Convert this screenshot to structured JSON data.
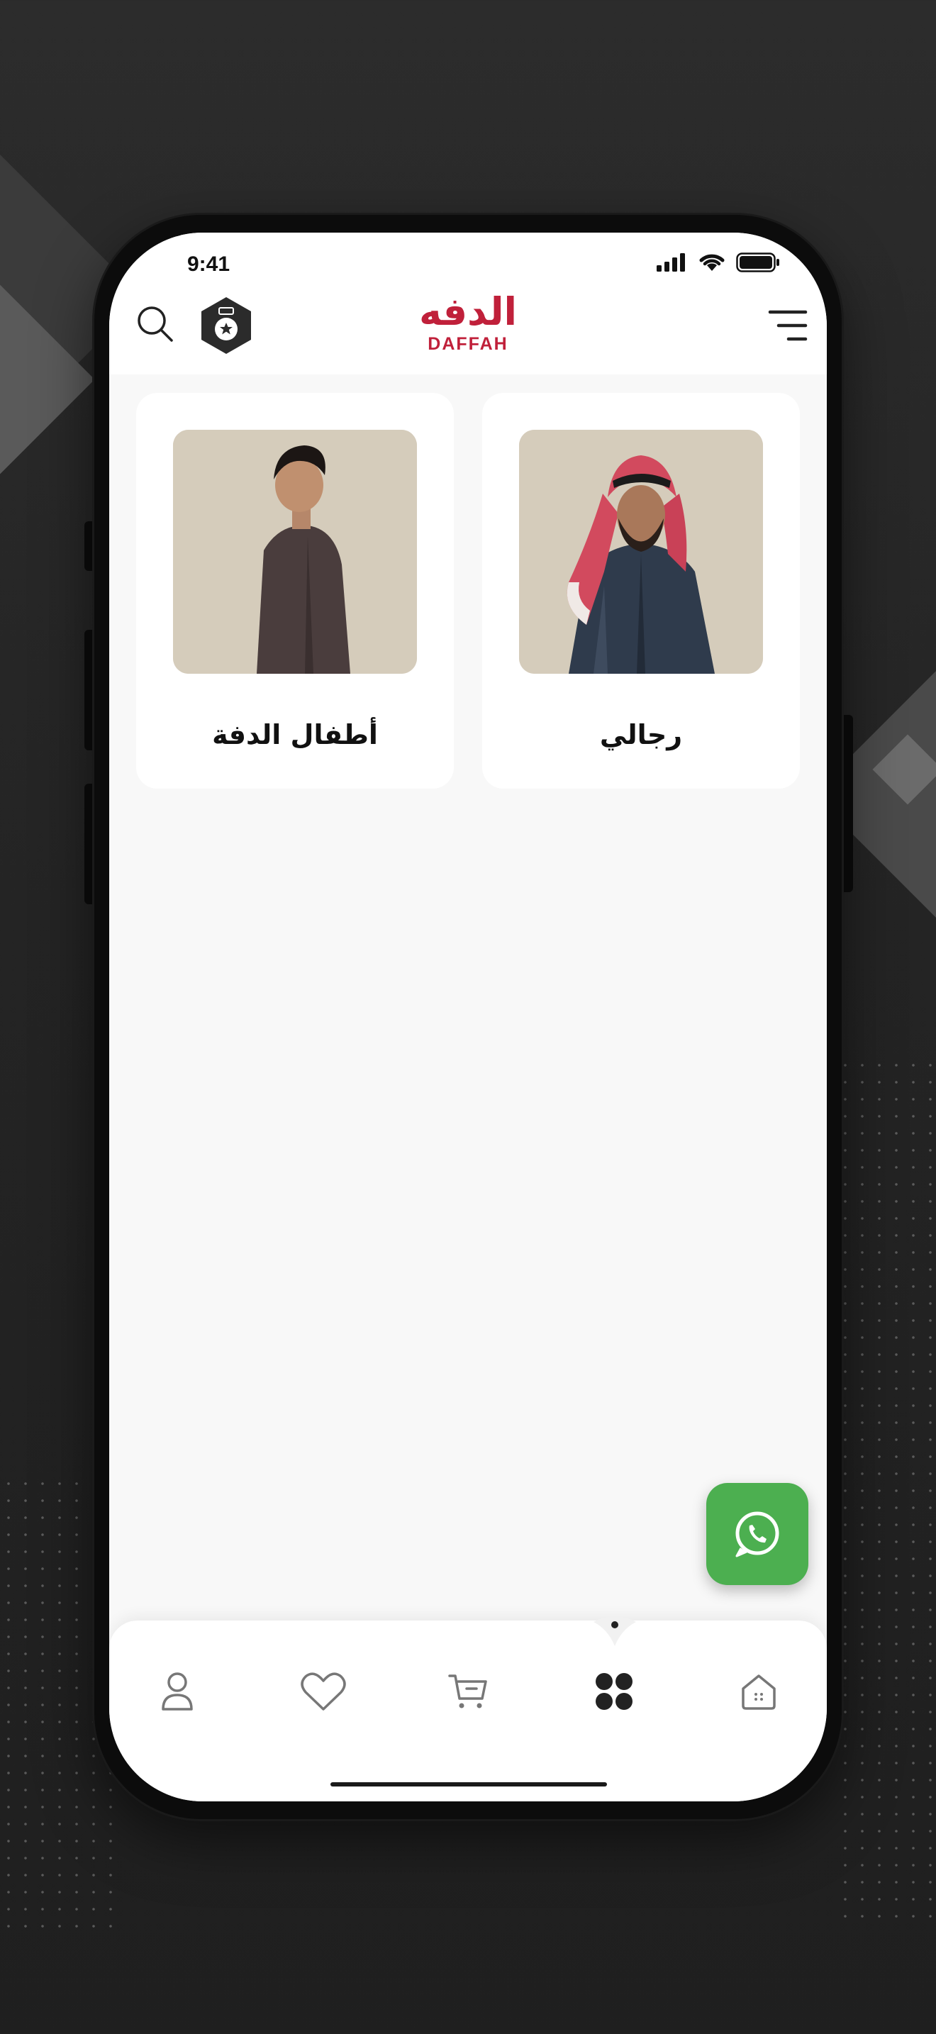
{
  "status_bar": {
    "time": "9:41"
  },
  "header": {
    "logo_arabic": "الدفه",
    "logo_english": "DAFFAH",
    "icons": [
      "search-icon",
      "badge-icon",
      "menu-icon"
    ]
  },
  "categories": [
    {
      "label": "رجالي"
    },
    {
      "label": "أطفال الدفة"
    }
  ],
  "tabs": [
    {
      "icon": "user-icon"
    },
    {
      "icon": "heart-icon"
    },
    {
      "icon": "cart-icon"
    },
    {
      "icon": "categories-icon",
      "active": true
    },
    {
      "icon": "home-icon"
    }
  ],
  "colors": {
    "brand": "#c0203a",
    "whatsapp": "#4caf50",
    "image_bg": "#d5ccbb"
  }
}
